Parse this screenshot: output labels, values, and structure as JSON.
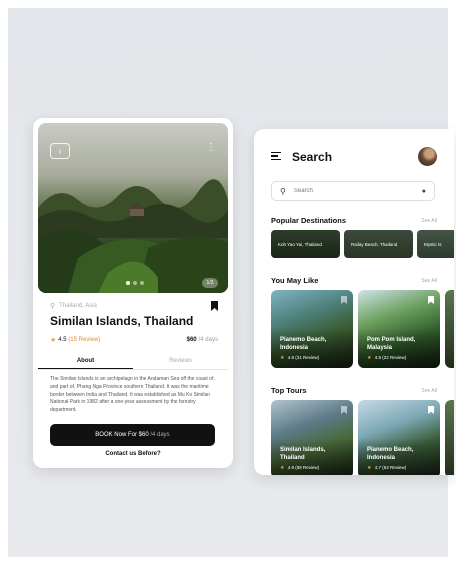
{
  "detail": {
    "location": "Thailand, Asia",
    "title": "Similan Islands, Thailand",
    "rating": "4.5",
    "reviews": "(15 Review)",
    "price": "$60",
    "per": "/4 days",
    "tabs": [
      {
        "label": "About"
      },
      {
        "label": "Reviews"
      }
    ],
    "description": "The Similan Islands is an archipelago in the Andaman Sea off the coast of, and part of, Phang Nga Province southern Thailand. It was the maritime border between India and Thailand. It was established as Mu Ko Similan National Park in 1982 after a one-year assessment by the forestry department.",
    "book_label": "BOOK Now For $60",
    "book_days": "/4 days",
    "contact": "Contact us Before?",
    "photo_count": "1/3"
  },
  "search": {
    "title": "Search",
    "placeholder": "Search",
    "popular": {
      "heading": "Popular Destinations",
      "see_all": "See All",
      "items": [
        {
          "label": "Koh Yao Yai, Thailand"
        },
        {
          "label": "Railay Beach, Thailand"
        },
        {
          "label": "Mystic Is"
        }
      ]
    },
    "you_may_like": {
      "heading": "You May Like",
      "see_all": "See All",
      "items": [
        {
          "name": "Pianemo Beach, Indonesia",
          "rating": "4.8",
          "reviews": "(31 Review)"
        },
        {
          "name": "Pom Pom Island, Malaysia",
          "rating": "4.9",
          "reviews": "(22 Review)"
        }
      ]
    },
    "top_tours": {
      "heading": "Top Tours",
      "see_all": "See All",
      "items": [
        {
          "name": "Similan Islands, Thailand",
          "rating": "4.9",
          "reviews": "(88 Review)"
        },
        {
          "name": "Pianemo Beach, Indonesia",
          "rating": "4.7",
          "reviews": "(63 Review)"
        }
      ]
    }
  },
  "icons": {
    "back": "back-arrow-icon",
    "more": "more-vertical-icon",
    "location": "location-pin-icon",
    "bookmark": "bookmark-icon",
    "menu": "menu-icon",
    "search": "search-icon",
    "mic": "microphone-icon",
    "star": "star-icon"
  },
  "colors": {
    "accent_star": "#f2a33a",
    "button": "#111111"
  }
}
